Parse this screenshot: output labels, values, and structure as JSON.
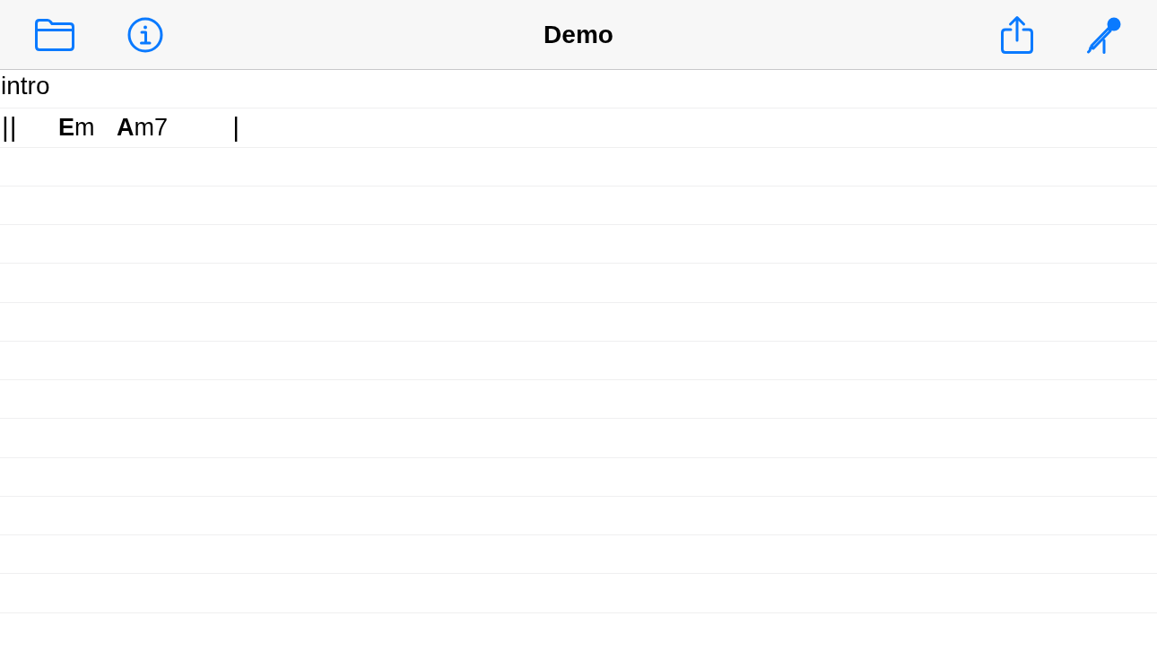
{
  "nav_bar": {
    "title": "Demo"
  },
  "lines": [
    {
      "kind": "section",
      "text": "intro"
    },
    {
      "kind": "chords",
      "items": [
        {
          "kind": "barline",
          "text": "||"
        },
        {
          "kind": "chord",
          "text": "**E**m"
        },
        {
          "kind": "chord",
          "text": "**A**m7"
        },
        {
          "kind": "barline",
          "text": "|"
        }
      ]
    }
  ]
}
